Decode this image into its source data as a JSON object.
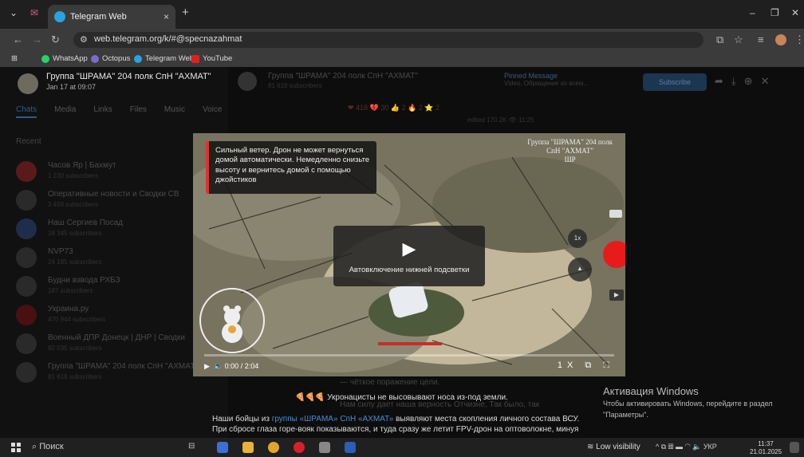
{
  "browser": {
    "tab_title": "Telegram Web",
    "tab_close": "×",
    "new_tab": "+",
    "url": "web.telegram.org/k/#@specnazahmat",
    "bookmarks": [
      "WhatsApp",
      "Octopus",
      "Telegram Web",
      "YouTube"
    ],
    "window_controls": [
      "–",
      "❐",
      "✕"
    ]
  },
  "chat": {
    "title": "Группа \"ШРАМА\" 204 полк СпН \"АХМАТ\"",
    "date": "Jan 17 at 09:07",
    "tabs": [
      "Chats",
      "Media",
      "Links",
      "Files",
      "Music",
      "Voice"
    ],
    "recent_label": "Recent",
    "channels": [
      {
        "name": "Часов Яр | Бахмут",
        "sub": "1 230 subscribers"
      },
      {
        "name": "Оперативные новости и Сводки СВ",
        "sub": "3 459 subscribers"
      },
      {
        "name": "Наш Сергиев Посад",
        "sub": "18 345 subscribers"
      },
      {
        "name": "NVP73",
        "sub": "24 185 subscribers"
      },
      {
        "name": "Будни взвода РХБЗ",
        "sub": "187 subscribers"
      },
      {
        "name": "Украина.ру",
        "sub": "470 944 subscribers"
      },
      {
        "name": "Военный ДПР Донецк | ДНР | Сводки",
        "sub": "82 035 subscribers"
      },
      {
        "name": "Группа \"ШРАМА\" 204 полк СпН \"АХМАТ\"",
        "sub": "81 618 subscribers"
      }
    ],
    "header_title": "Группа \"ШРАМА\" 204 полк СпН \"АХМАТ\"",
    "header_sub": "81 618 subscribers",
    "pinned_title": "Pinned Message",
    "pinned_text": "Video, Обращение ко всем...",
    "subscribe": "Subscribe",
    "reactions": "❤ 418   💔 30   👍 2   🔥 2   ⭐ 2",
    "views": "edited 170.2K 👁 11:25"
  },
  "video": {
    "notice": "Сильный ветер. Дрон не может вернуться домой автоматически. Немедленно снизьте высоту и вернитесь домой с помощью джойстиков",
    "watermark_line1": "Группа \"ШРАМА\" 204 полк",
    "watermark_line2": "СпН \"АХМАТ\"",
    "watermark_line3": "ШР",
    "play_caption": "Автовключение нижней подсветки",
    "speed_badge": "1x",
    "time": "0:00 / 2:04",
    "speed": "1X",
    "progress": 0.0
  },
  "captions": {
    "line1": "🍕🍕🍕 Укронацисты не высовывают носа из-под земли.",
    "line2_pre": "Наши бойцы из ",
    "line2_link": "группы «ШРАМА» СпН «АХМАТ»",
    "line2_post": " выявляют места скопления личного состава ВСУ.",
    "line3": "При сбросе глаза горе-вояк показываются, и туда сразу же летит FPV-дрон на оптоволокне, минуя",
    "bg1": "— чёткое поражение цели.",
    "bg2": "Нам силу дает наша верность Отчизне, Так было, так"
  },
  "windows_activation": {
    "title": "Активация Windows",
    "text1": "Чтобы активировать Windows, перейдите в раздел",
    "text2": "\"Параметры\"."
  },
  "taskbar": {
    "search": "Поиск",
    "visibility": "Low visibility",
    "lang": "УКР",
    "time": "11:37",
    "date": "21.01.2025"
  }
}
